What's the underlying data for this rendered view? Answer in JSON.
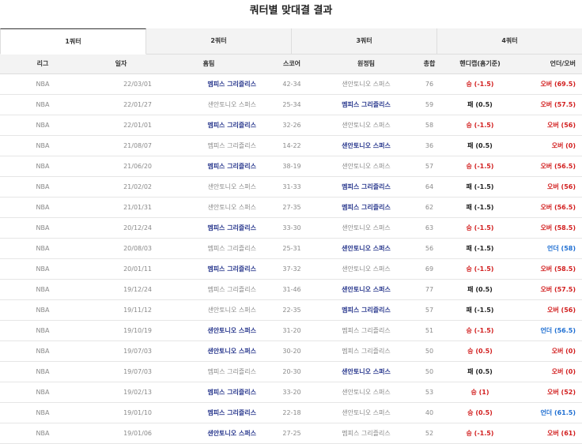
{
  "title": "쿼터별 맞대결 결과",
  "tabs": [
    "1쿼터",
    "2쿼터",
    "3쿼터",
    "4쿼터"
  ],
  "active_tab": 0,
  "columns": [
    "리그",
    "일자",
    "홈팀",
    "스코어",
    "원정팀",
    "총합",
    "핸디캡(홈기준)",
    "언더/오버"
  ],
  "colors": {
    "win_team": "#2b3a8f",
    "lose_team": "#8a8a8a",
    "win": "#d21f1f",
    "under": "#1f6fd2",
    "lose": "#222222"
  },
  "rows": [
    {
      "league": "NBA",
      "date": "22/03/01",
      "home": "멤피스 그리즐리스",
      "home_win": true,
      "score": "42-34",
      "away": "샌안토니오 스퍼스",
      "away_win": false,
      "total": "76",
      "handicap": "승 (-1.5)",
      "hc_type": "win",
      "ou": "오버 (69.5)",
      "ou_type": "over"
    },
    {
      "league": "NBA",
      "date": "22/01/27",
      "home": "샌안토니오 스퍼스",
      "home_win": false,
      "score": "25-34",
      "away": "멤피스 그리즐리스",
      "away_win": true,
      "total": "59",
      "handicap": "패 (0.5)",
      "hc_type": "lose",
      "ou": "오버 (57.5)",
      "ou_type": "over"
    },
    {
      "league": "NBA",
      "date": "22/01/01",
      "home": "멤피스 그리즐리스",
      "home_win": true,
      "score": "32-26",
      "away": "샌안토니오 스퍼스",
      "away_win": false,
      "total": "58",
      "handicap": "승 (-1.5)",
      "hc_type": "win",
      "ou": "오버 (56)",
      "ou_type": "over"
    },
    {
      "league": "NBA",
      "date": "21/08/07",
      "home": "멤피스 그리즐리스",
      "home_win": false,
      "score": "14-22",
      "away": "샌안토니오 스퍼스",
      "away_win": true,
      "total": "36",
      "handicap": "패 (0.5)",
      "hc_type": "lose",
      "ou": "오버 (0)",
      "ou_type": "over"
    },
    {
      "league": "NBA",
      "date": "21/06/20",
      "home": "멤피스 그리즐리스",
      "home_win": true,
      "score": "38-19",
      "away": "샌안토니오 스퍼스",
      "away_win": false,
      "total": "57",
      "handicap": "승 (-1.5)",
      "hc_type": "win",
      "ou": "오버 (56.5)",
      "ou_type": "over"
    },
    {
      "league": "NBA",
      "date": "21/02/02",
      "home": "샌안토니오 스퍼스",
      "home_win": false,
      "score": "31-33",
      "away": "멤피스 그리즐리스",
      "away_win": true,
      "total": "64",
      "handicap": "패 (-1.5)",
      "hc_type": "lose",
      "ou": "오버 (56)",
      "ou_type": "over"
    },
    {
      "league": "NBA",
      "date": "21/01/31",
      "home": "샌안토니오 스퍼스",
      "home_win": false,
      "score": "27-35",
      "away": "멤피스 그리즐리스",
      "away_win": true,
      "total": "62",
      "handicap": "패 (-1.5)",
      "hc_type": "lose",
      "ou": "오버 (56.5)",
      "ou_type": "over"
    },
    {
      "league": "NBA",
      "date": "20/12/24",
      "home": "멤피스 그리즐리스",
      "home_win": true,
      "score": "33-30",
      "away": "샌안토니오 스퍼스",
      "away_win": false,
      "total": "63",
      "handicap": "승 (-1.5)",
      "hc_type": "win",
      "ou": "오버 (58.5)",
      "ou_type": "over"
    },
    {
      "league": "NBA",
      "date": "20/08/03",
      "home": "멤피스 그리즐리스",
      "home_win": false,
      "score": "25-31",
      "away": "샌안토니오 스퍼스",
      "away_win": true,
      "total": "56",
      "handicap": "패 (-1.5)",
      "hc_type": "lose",
      "ou": "언더 (58)",
      "ou_type": "under"
    },
    {
      "league": "NBA",
      "date": "20/01/11",
      "home": "멤피스 그리즐리스",
      "home_win": true,
      "score": "37-32",
      "away": "샌안토니오 스퍼스",
      "away_win": false,
      "total": "69",
      "handicap": "승 (-1.5)",
      "hc_type": "win",
      "ou": "오버 (58.5)",
      "ou_type": "over"
    },
    {
      "league": "NBA",
      "date": "19/12/24",
      "home": "멤피스 그리즐리스",
      "home_win": false,
      "score": "31-46",
      "away": "샌안토니오 스퍼스",
      "away_win": true,
      "total": "77",
      "handicap": "패 (0.5)",
      "hc_type": "lose",
      "ou": "오버 (57.5)",
      "ou_type": "over"
    },
    {
      "league": "NBA",
      "date": "19/11/12",
      "home": "샌안토니오 스퍼스",
      "home_win": false,
      "score": "22-35",
      "away": "멤피스 그리즐리스",
      "away_win": true,
      "total": "57",
      "handicap": "패 (-1.5)",
      "hc_type": "lose",
      "ou": "오버 (56)",
      "ou_type": "over"
    },
    {
      "league": "NBA",
      "date": "19/10/19",
      "home": "샌안토니오 스퍼스",
      "home_win": true,
      "score": "31-20",
      "away": "멤피스 그리즐리스",
      "away_win": false,
      "total": "51",
      "handicap": "승 (-1.5)",
      "hc_type": "win",
      "ou": "언더 (56.5)",
      "ou_type": "under"
    },
    {
      "league": "NBA",
      "date": "19/07/03",
      "home": "샌안토니오 스퍼스",
      "home_win": true,
      "score": "30-20",
      "away": "멤피스 그리즐리스",
      "away_win": false,
      "total": "50",
      "handicap": "승 (0.5)",
      "hc_type": "win",
      "ou": "오버 (0)",
      "ou_type": "over"
    },
    {
      "league": "NBA",
      "date": "19/07/03",
      "home": "멤피스 그리즐리스",
      "home_win": false,
      "score": "20-30",
      "away": "샌안토니오 스퍼스",
      "away_win": true,
      "total": "50",
      "handicap": "패 (0.5)",
      "hc_type": "lose",
      "ou": "오버 (0)",
      "ou_type": "over"
    },
    {
      "league": "NBA",
      "date": "19/02/13",
      "home": "멤피스 그리즐리스",
      "home_win": true,
      "score": "33-20",
      "away": "샌안토니오 스퍼스",
      "away_win": false,
      "total": "53",
      "handicap": "승 (1)",
      "hc_type": "win",
      "ou": "오버 (52)",
      "ou_type": "over"
    },
    {
      "league": "NBA",
      "date": "19/01/10",
      "home": "멤피스 그리즐리스",
      "home_win": true,
      "score": "22-18",
      "away": "샌안토니오 스퍼스",
      "away_win": false,
      "total": "40",
      "handicap": "승 (0.5)",
      "hc_type": "win",
      "ou": "언더 (61.5)",
      "ou_type": "under"
    },
    {
      "league": "NBA",
      "date": "19/01/06",
      "home": "샌안토니오 스퍼스",
      "home_win": true,
      "score": "27-25",
      "away": "멤피스 그리즐리스",
      "away_win": false,
      "total": "52",
      "handicap": "승 (-1.5)",
      "hc_type": "win",
      "ou": "오버 (61)",
      "ou_type": "over"
    }
  ]
}
